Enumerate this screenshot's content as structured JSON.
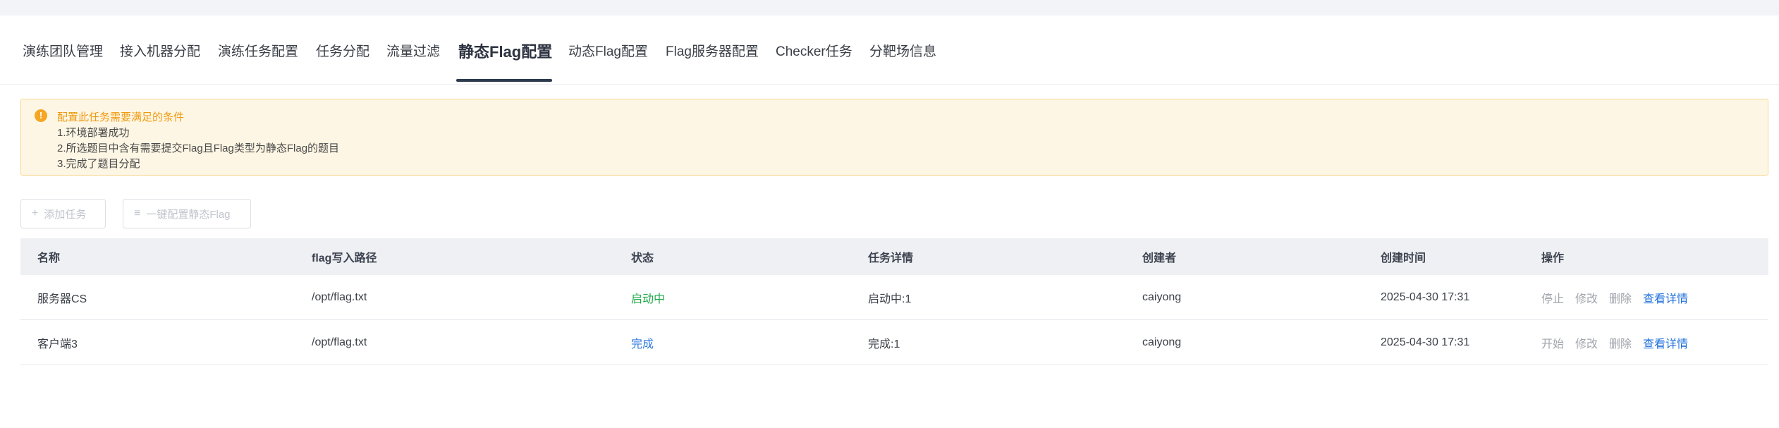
{
  "tabs": [
    {
      "label": "演练团队管理"
    },
    {
      "label": "接入机器分配"
    },
    {
      "label": "演练任务配置"
    },
    {
      "label": "任务分配"
    },
    {
      "label": "流量过滤"
    },
    {
      "label": "静态Flag配置",
      "active": true
    },
    {
      "label": "动态Flag配置"
    },
    {
      "label": "Flag服务器配置"
    },
    {
      "label": "Checker任务"
    },
    {
      "label": "分靶场信息"
    }
  ],
  "alert": {
    "icon": "warning-circle-icon",
    "title": "配置此任务需要满足的条件",
    "lines": [
      "1.环境部署成功",
      "2.所选题目中含有需要提交Flag且Flag类型为静态Flag的题目",
      "3.完成了题目分配"
    ]
  },
  "toolbar": {
    "add_label": "添加任务",
    "add_icon": "plus-icon",
    "config_label": "一键配置静态Flag",
    "config_icon": "list-icon"
  },
  "table": {
    "headers": [
      "名称",
      "flag写入路径",
      "状态",
      "任务详情",
      "创建者",
      "创建时间",
      "操作"
    ],
    "rows": [
      {
        "name": "服务器CS",
        "path": "/opt/flag.txt",
        "status": "启动中",
        "detail": "启动中:1",
        "creator": "caiyong",
        "created": "2025-04-30 17:31",
        "ops": [
          "停止",
          "修改",
          "删除"
        ],
        "view": "查看详情"
      },
      {
        "name": "客户端3",
        "path": "/opt/flag.txt",
        "status": "完成",
        "detail": "完成:1",
        "creator": "caiyong",
        "created": "2025-04-30 17:31",
        "ops": [
          "开始",
          "修改",
          "删除"
        ],
        "view": "查看详情"
      }
    ]
  },
  "colors": {
    "accent": "#2d3a4f",
    "warning": "#f09a10",
    "running": "#1fa94a",
    "done": "#2a77e0",
    "link": "#1f6fdb"
  }
}
